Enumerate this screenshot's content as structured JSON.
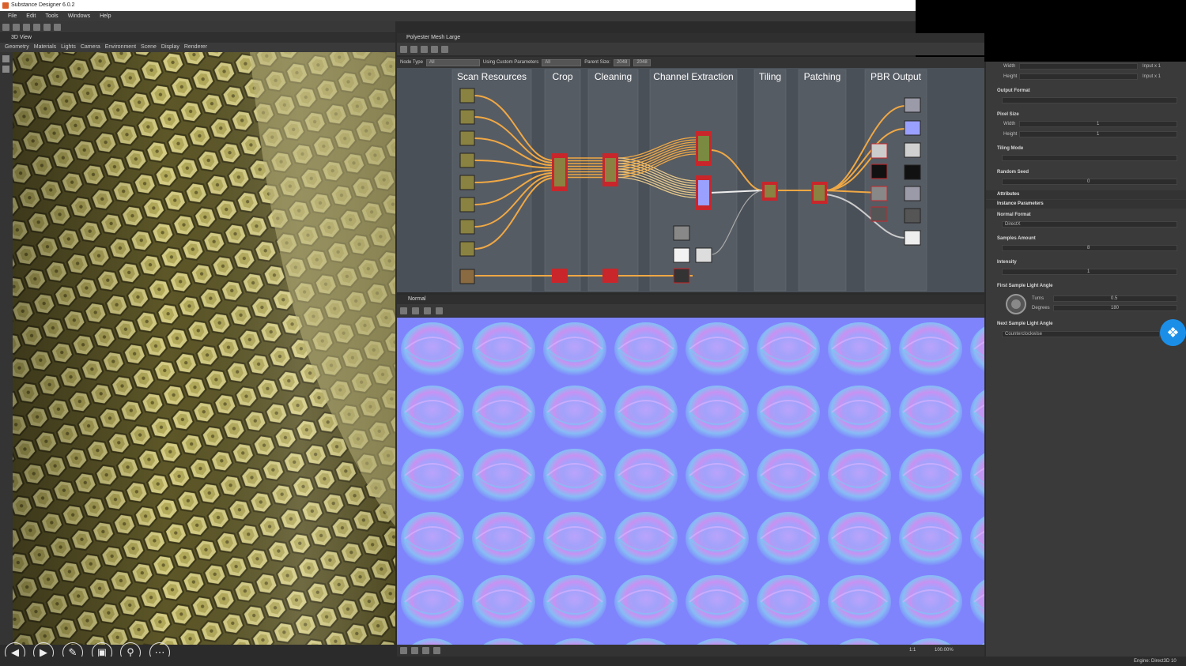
{
  "app": {
    "title": "Substance Designer 6.0.2"
  },
  "menu": [
    "File",
    "Edit",
    "Tools",
    "Windows",
    "Help"
  ],
  "view3d": {
    "title": "3D View",
    "menu": [
      "Geometry",
      "Materials",
      "Lights",
      "Camera",
      "Environment",
      "Scene",
      "Display",
      "Renderer"
    ]
  },
  "graph": {
    "title": "Polyester Mesh Large",
    "filter": {
      "node_type_label": "Node Type",
      "node_type_value": "All",
      "custom_params_label": "Using Custom Parameters",
      "custom_params_value": "All",
      "parent_size_label": "Parent Size:",
      "parent_size_value": "2048",
      "size_value": "2048"
    },
    "frames": [
      "Scan Resources",
      "Crop",
      "Cleaning",
      "Channel Extraction",
      "Tiling",
      "Patching",
      "PBR Output"
    ]
  },
  "normal": {
    "title": "Normal",
    "size_ratio": "1:1",
    "zoom": "100.00%"
  },
  "properties": {
    "width_label": "Width",
    "height_label": "Height",
    "width_value": "Input x 1",
    "height_value": "Input x 1",
    "output_format": "Output Format",
    "pixel_size": "Pixel Size",
    "pixel_width_label": "Width",
    "pixel_height_label": "Height",
    "pixel_width_value": "1",
    "pixel_height_value": "1",
    "tiling_mode": "Tiling Mode",
    "random_seed": "Random Seed",
    "random_seed_value": "0",
    "attributes": "Attributes",
    "instance_parameters": "Instance Parameters",
    "normal_format": "Normal Format",
    "normal_format_value": "DirectX",
    "samples_amount": "Samples Amount",
    "samples_amount_value": "8",
    "intensity": "Intensity",
    "intensity_value": "1",
    "first_sample_light_angle": "First Sample Light Angle",
    "turns_label": "Turns",
    "turns_value": "0.5",
    "degrees_label": "Degrees",
    "degrees_value": "180",
    "next_sample_light_angle": "Next Sample Light Angle",
    "next_sample_value": "Counterclockwise"
  },
  "status": {
    "engine": "Engine: Direct3D 10"
  },
  "colors": {
    "accent": "#f0a844",
    "node_red": "#c8262b",
    "normal_bg": "#8a8cff",
    "fabric": "#c9c07a"
  }
}
